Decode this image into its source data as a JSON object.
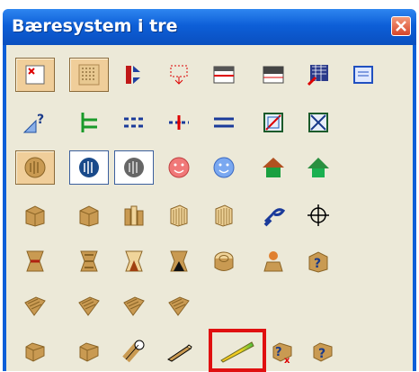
{
  "window": {
    "title": "Bæresystem i tre"
  },
  "toolbar": {
    "rows": [
      [
        "frame-select-icon",
        "grid-dots-icon",
        "split-column-icon",
        "dashed-drop-icon",
        "panel-red-line-icon",
        "panel-grey-icon",
        "grid-arrow-icon",
        "blue-window-icon"
      ],
      [
        "ruler-help-icon",
        "beam-bracket-icon",
        "dashed-lines-icon",
        "red-cross-line-icon",
        "double-line-icon",
        "boxed-slash-icon",
        "boxed-cross-icon"
      ],
      [
        "round-column-icon",
        "column-blue-icon",
        "column-grey-icon",
        "red-face-icon",
        "blue-face-icon",
        "house-green-icon",
        "roof-green-icon"
      ],
      [
        "wood-block-icon",
        "wood-block-2-icon",
        "wood-stack-icon",
        "wood-panel-icon",
        "wood-panel-2-icon",
        "wrench-hand-icon",
        "crosshair-icon"
      ],
      [
        "joint-red-icon",
        "joint-dark-icon",
        "joint-cone-icon",
        "joint-black-icon",
        "log-end-icon",
        "log-cap-icon",
        "wood-help-icon"
      ],
      [
        "plank-icon",
        "plank-2-icon",
        "plank-3-icon",
        "plank-4-icon"
      ],
      [
        "beam-icon",
        "beam-2-icon",
        "round-beam-icon",
        "long-beam-icon",
        "slab-beam-icon",
        "beam-help-x-icon",
        "beam-help-icon"
      ]
    ],
    "highlighted": "slab-beam-icon",
    "pressed": [
      "frame-select-icon",
      "grid-dots-icon",
      "round-column-icon"
    ],
    "framed": [
      "column-blue-icon",
      "column-grey-icon"
    ]
  },
  "colors": {
    "titlebar": "#0d5fd8",
    "highlight": "#e01010",
    "panel": "#ece9d8"
  }
}
